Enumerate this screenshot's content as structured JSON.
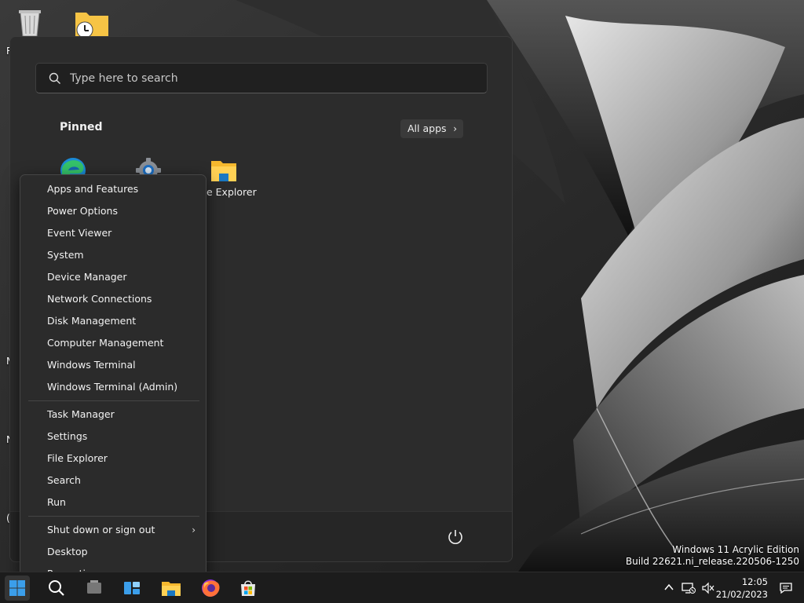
{
  "search": {
    "placeholder": "Type here to search"
  },
  "start_menu": {
    "pinned_title": "Pinned",
    "all_apps_label": "All apps",
    "pinned_apps": [
      {
        "label": "",
        "icon": "edge-icon"
      },
      {
        "label": "",
        "icon": "settings-gear-icon"
      },
      {
        "label": "e Explorer",
        "icon": "file-explorer-folder-icon"
      }
    ]
  },
  "context_menu": {
    "group1": [
      "Apps and Features",
      "Power Options",
      "Event Viewer",
      "System",
      "Device Manager",
      "Network Connections",
      "Disk Management",
      "Computer Management",
      "Windows Terminal",
      "Windows Terminal (Admin)"
    ],
    "group2": [
      "Task Manager",
      "Settings",
      "File Explorer",
      "Search",
      "Run"
    ],
    "group3": [
      "Shut down or sign out",
      "Desktop",
      "Properties"
    ]
  },
  "desktop": {
    "peek_labels": [
      "R",
      "M",
      "N",
      "("
    ]
  },
  "watermark": {
    "line1": "Windows 11 Acrylic Edition",
    "line2": "Build 22621.ni_release.220506-1250"
  },
  "taskbar": {
    "time": "12:05",
    "date": "21/02/2023",
    "apps": [
      "start-icon",
      "search-icon",
      "task-view-icon",
      "widgets-icon",
      "file-explorer-icon",
      "firefox-icon",
      "microsoft-store-icon"
    ]
  },
  "colors": {
    "accent": "#0078d4",
    "menu_bg": "#2b2b2b",
    "start_bg": "#2c2c2c",
    "taskbar_bg": "#1c1c1c"
  }
}
